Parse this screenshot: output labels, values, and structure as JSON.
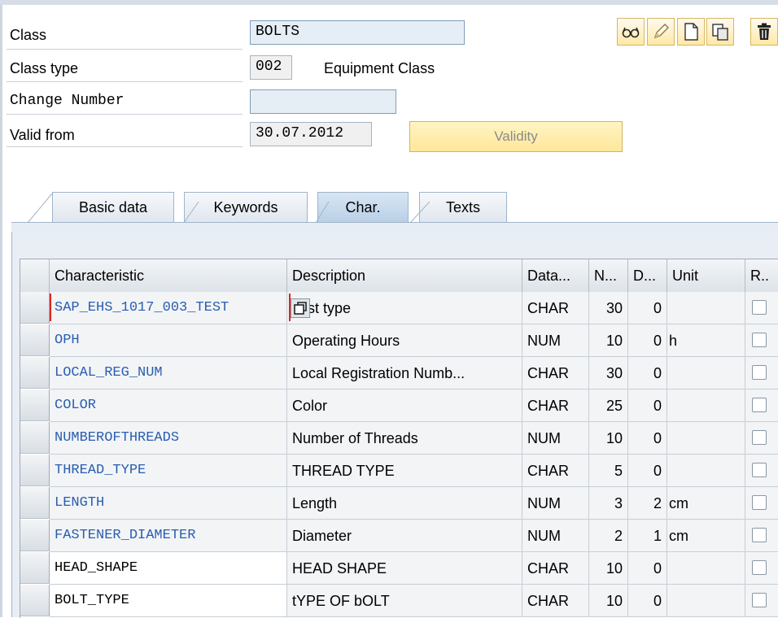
{
  "header": {
    "class_label": "Class",
    "class_value": "BOLTS",
    "class_type_label": "Class type",
    "class_type_value": "002",
    "class_type_desc": "Equipment Class",
    "change_number_label": "Change Number",
    "change_number_value": "",
    "valid_from_label": "Valid from",
    "valid_from_value": "30.07.2012",
    "validity_button": "Validity"
  },
  "toolbar": {
    "icons": [
      "glasses-icon",
      "pencil-icon",
      "new-document-icon",
      "copy-icon",
      "trash-icon"
    ]
  },
  "tabs": [
    {
      "label": "Basic data",
      "active": false
    },
    {
      "label": "Keywords",
      "active": false
    },
    {
      "label": "Char.",
      "active": true
    },
    {
      "label": "Texts",
      "active": false
    }
  ],
  "grid": {
    "columns": [
      "Characteristic",
      "Description",
      "Data...",
      "N...",
      "D...",
      "Unit",
      "R.."
    ],
    "rows": [
      {
        "characteristic": "SAP_EHS_1017_003_TEST",
        "description": "Test type",
        "data_type": "CHAR",
        "n": "30",
        "d": "0",
        "unit": "",
        "editable": false
      },
      {
        "characteristic": "OPH",
        "description": "Operating Hours",
        "data_type": "NUM",
        "n": "10",
        "d": "0",
        "unit": "h",
        "editable": false
      },
      {
        "characteristic": "LOCAL_REG_NUM",
        "description": "Local Registration Numb...",
        "data_type": "CHAR",
        "n": "30",
        "d": "0",
        "unit": "",
        "editable": false
      },
      {
        "characteristic": "COLOR",
        "description": "Color",
        "data_type": "CHAR",
        "n": "25",
        "d": "0",
        "unit": "",
        "editable": false
      },
      {
        "characteristic": "NUMBEROFTHREADS",
        "description": "Number of Threads",
        "data_type": "NUM",
        "n": "10",
        "d": "0",
        "unit": "",
        "editable": false
      },
      {
        "characteristic": "THREAD_TYPE",
        "description": "THREAD TYPE",
        "data_type": "CHAR",
        "n": "5",
        "d": "0",
        "unit": "",
        "editable": false
      },
      {
        "characteristic": "LENGTH",
        "description": "Length",
        "data_type": "NUM",
        "n": "3",
        "d": "2",
        "unit": "cm",
        "editable": false
      },
      {
        "characteristic": "FASTENER_DIAMETER",
        "description": "Diameter",
        "data_type": "NUM",
        "n": "2",
        "d": "1",
        "unit": "cm",
        "editable": false
      },
      {
        "characteristic": "HEAD_SHAPE",
        "description": "HEAD SHAPE",
        "data_type": "CHAR",
        "n": "10",
        "d": "0",
        "unit": "",
        "editable": true
      },
      {
        "characteristic": "BOLT_TYPE",
        "description": "tYPE OF bOLT",
        "data_type": "CHAR",
        "n": "10",
        "d": "0",
        "unit": "",
        "editable": true
      }
    ]
  }
}
